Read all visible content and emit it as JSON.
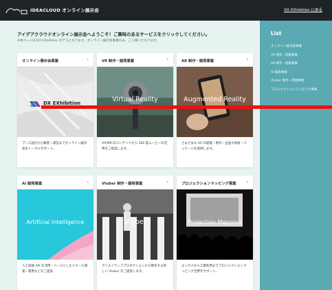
{
  "header": {
    "brand": "IDEACLOUD オンライン展示会",
    "back_link": "DX EXhibition に戻る"
  },
  "intro": {
    "title": "アイデアクラウドオンライン展示会へようこそ！ご興味のあるサービスをクリックしてください。",
    "note": "※本ページは DX EXhibition のデモとなります。オンライン展示会事業のみ、ご入場いただけます。"
  },
  "cards": [
    {
      "title": "オンライン展示会事業",
      "image_label": "DX EXhibition",
      "desc": "ブース設計から集客・運営までオンライン展示会をトータルサポート。"
    },
    {
      "title": "VR 制作・開発事業",
      "image_label": "Virtual Reality",
      "desc": "VR/MR 向コンテンツから 360 度ムービーの活用をご提案します。"
    },
    {
      "title": "AR 制作・開発事業",
      "image_label": "Augmented Reality",
      "desc": "さまざまな AR の開発・制作・企画や技術・パッケージを提供します。"
    },
    {
      "title": "AI 開発事業",
      "image_label": "Artificial Intelligence",
      "desc": "人工知能 API を活用・ベースにしたスクール開発・運用などをご提案"
    },
    {
      "title": "Vtuber 制作・開発事業",
      "image_label": "Vtuber",
      "desc": "クリエイティブプロダクションから制作する新しい Vtuber をご提案します。"
    },
    {
      "title": "プロジェクションマッピング事業",
      "image_label": "Projection Mapping",
      "desc": "エンタメから工業利用までプロジェクションマッピング活用をサポート。"
    }
  ],
  "chevron": "›",
  "sidebar": {
    "title": "List",
    "items": [
      "オンライン展示会事業",
      "VR 制作・開発事業",
      "AR 制作・開発事業",
      "AI 開発事業",
      "Vtuber 制作・開発事業",
      "プロジェクションマッピング事業"
    ]
  },
  "colors": {
    "header_bg": "#1d2327",
    "main_bg": "#e7f3f1",
    "sidebar_bg": "#5aa9b3",
    "overlay_red": "#ee1111",
    "ai_cyan": "#27c7dc",
    "ai_pink": "#f4a6c6"
  },
  "icons": {
    "brand": "cloud-logo-icon",
    "chevron": "chevron-right-icon"
  }
}
